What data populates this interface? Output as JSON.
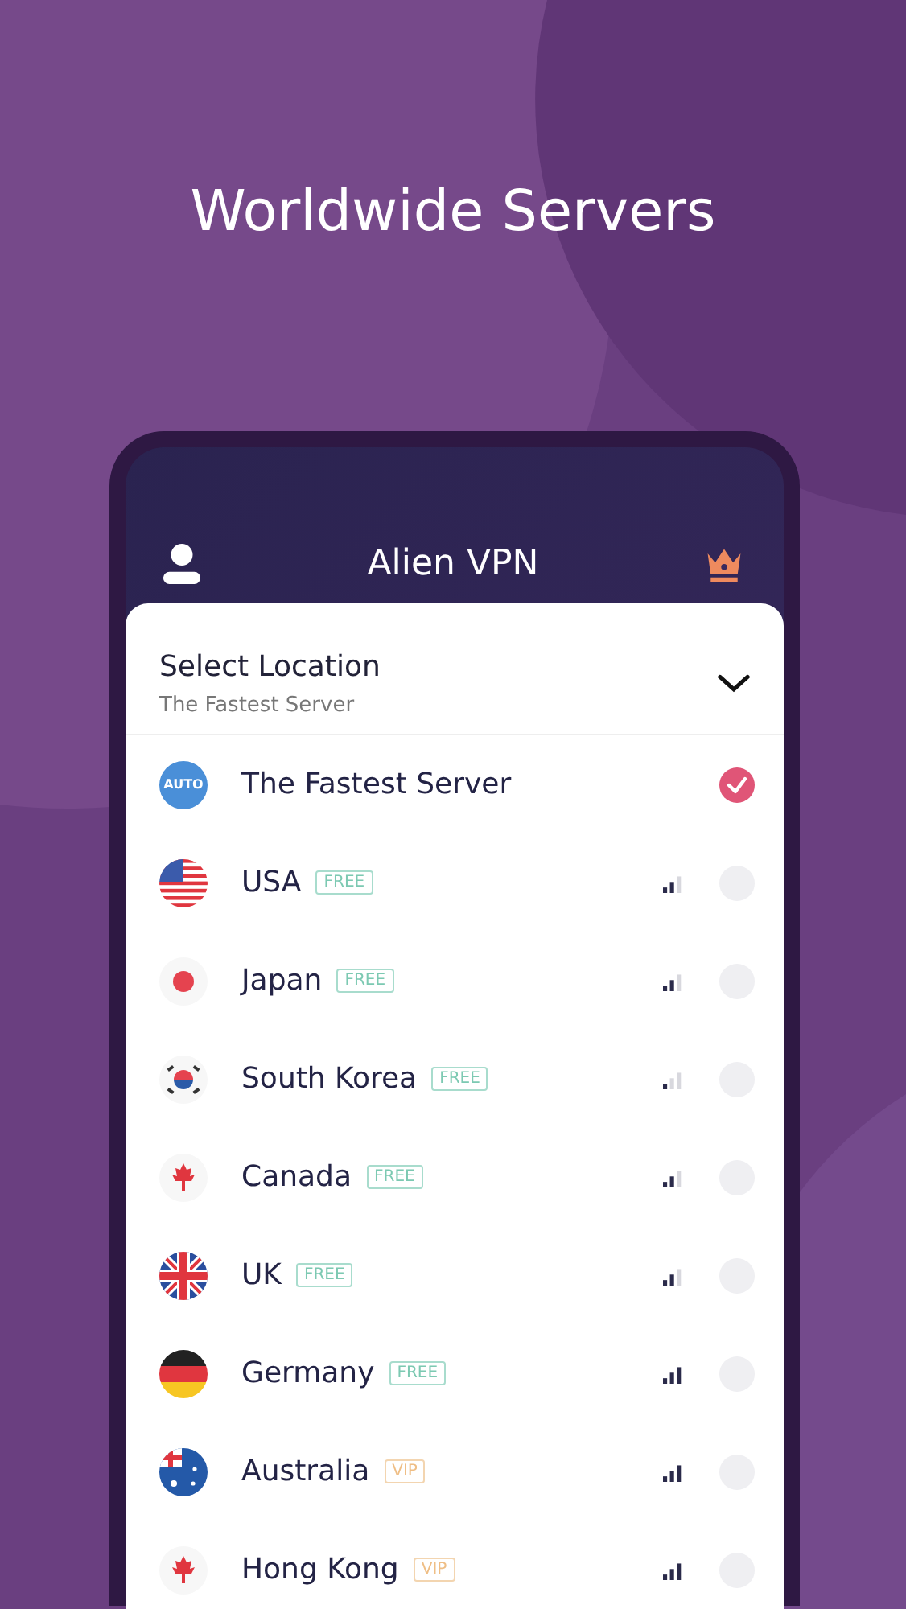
{
  "headline": "Worldwide Servers",
  "app_bar": {
    "title": "Alien VPN"
  },
  "location": {
    "title": "Select Location",
    "subtitle": "The Fastest Server"
  },
  "servers": [
    {
      "kind": "auto",
      "icon_text": "AUTO",
      "name": "The Fastest Server",
      "selected": true
    },
    {
      "kind": "usa",
      "name": "USA",
      "tier": {
        "label": "FREE",
        "kind": "free"
      },
      "signal": {
        "kind": "medium"
      },
      "selected": false
    },
    {
      "kind": "japan",
      "name": "Japan",
      "tier": {
        "label": "FREE",
        "kind": "free"
      },
      "signal": {
        "kind": "medium"
      },
      "selected": false
    },
    {
      "kind": "korea",
      "name": "South Korea",
      "tier": {
        "label": "FREE",
        "kind": "free"
      },
      "signal": {
        "kind": "weak"
      },
      "selected": false
    },
    {
      "kind": "canada",
      "name": "Canada",
      "tier": {
        "label": "FREE",
        "kind": "free"
      },
      "signal": {
        "kind": "medium"
      },
      "selected": false
    },
    {
      "kind": "uk",
      "name": "UK",
      "tier": {
        "label": "FREE",
        "kind": "free"
      },
      "signal": {
        "kind": "medium"
      },
      "selected": false
    },
    {
      "kind": "germany",
      "name": "Germany",
      "tier": {
        "label": "FREE",
        "kind": "free"
      },
      "signal": {
        "kind": "strong"
      },
      "selected": false
    },
    {
      "kind": "australia",
      "name": "Australia",
      "tier": {
        "label": "VIP",
        "kind": "vip"
      },
      "signal": {
        "kind": "strong"
      },
      "selected": false
    },
    {
      "kind": "canada",
      "name": "Hong Kong",
      "tier": {
        "label": "VIP",
        "kind": "vip"
      },
      "signal": {
        "kind": "strong"
      },
      "selected": false
    }
  ]
}
